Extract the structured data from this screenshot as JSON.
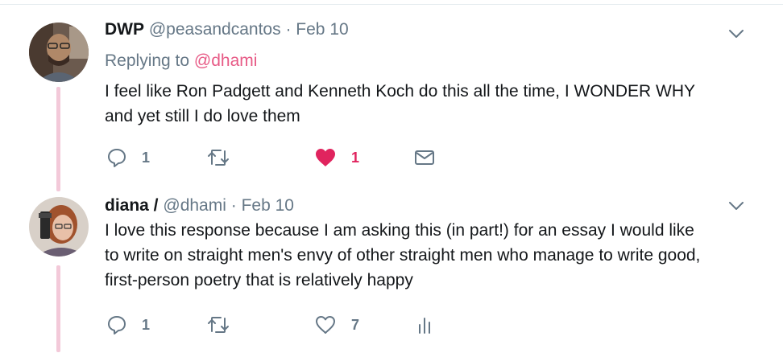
{
  "tweets": [
    {
      "name": "DWP",
      "handle": "@peasandcantos",
      "separator": "·",
      "time": "Feb 10",
      "replying_label": "Replying to",
      "replying_handle": "@dhami",
      "text_lines": [
        "I feel like Ron Padgett and Kenneth Koch do this all the time, I WONDER WHY",
        "and yet still I do love them"
      ],
      "reply_count": "1",
      "like_count": "1",
      "liked": true,
      "icons": [
        "reply-icon",
        "retweet-icon",
        "heart-filled-icon",
        "envelope-icon"
      ]
    },
    {
      "name": "diana /",
      "handle": "@dhami",
      "separator": "·",
      "time": "Feb 10",
      "text_lines": [
        "I love this response because I am asking this (in part!) for an essay I would like",
        "to write on straight men's envy of other straight men who manage to write good,",
        "first-person poetry that is relatively happy"
      ],
      "reply_count": "1",
      "like_count": "7",
      "liked": false,
      "icons": [
        "reply-icon",
        "retweet-icon",
        "heart-outline-icon",
        "analytics-icon"
      ]
    }
  ],
  "colors": {
    "like_active": "#e0245e",
    "thread_line": "#f3c9d9",
    "muted": "#657786",
    "text": "#14171a"
  }
}
